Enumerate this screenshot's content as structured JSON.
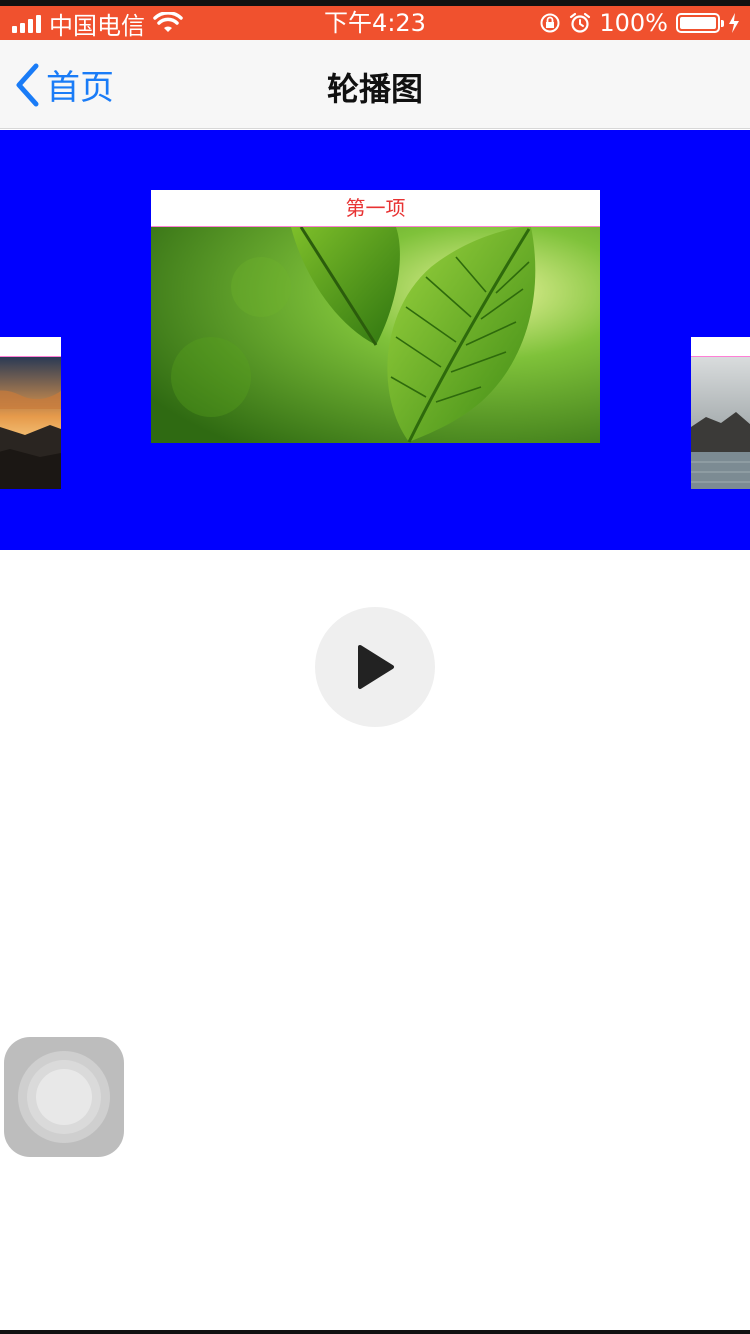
{
  "status_bar": {
    "carrier": "中国电信",
    "time": "下午4:23",
    "battery": "100%"
  },
  "nav": {
    "back_label": "首页",
    "title": "轮播图"
  },
  "carousel": {
    "active_caption": "第一项"
  },
  "colors": {
    "status_bg": "#f0512e",
    "carousel_bg": "#0000ff",
    "caption_text": "#e83333",
    "ios_blue": "#1a7cf7"
  },
  "icons": {
    "back": "chevron-left-icon",
    "play": "play-icon",
    "assistive": "assistive-touch-icon"
  }
}
